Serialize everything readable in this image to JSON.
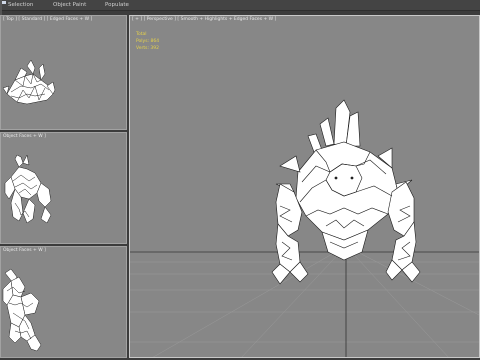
{
  "menu": {
    "items": [
      "Selection",
      "Object Paint",
      "Populate"
    ]
  },
  "viewports": {
    "top": {
      "label": "[ Top ] [ Standard ] [ Edged Faces + W ]"
    },
    "front": {
      "label": "Object Faces + W ]"
    },
    "left": {
      "label": "Object Faces + W ]"
    },
    "perspective": {
      "label": "[ + ] [ Perspective ] [ Smooth + Highlights + Edged Faces + W ]",
      "stats": {
        "total": "Total",
        "polys": "Polys: 864",
        "verts": "Verts: 392"
      }
    }
  },
  "colors": {
    "viewport_bg": "#878787",
    "active_border": "#c9c9c9",
    "stats_text": "#e6d24a",
    "mesh_fill": "#ffffff",
    "mesh_wire": "#1a1a1a"
  },
  "icons": [
    "extra-menu-icon"
  ]
}
